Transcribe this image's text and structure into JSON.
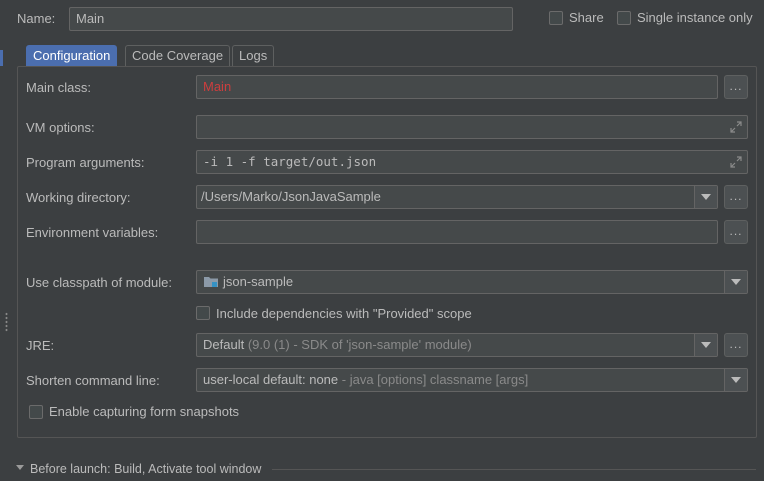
{
  "header": {
    "name_label": "Name:",
    "name_value": "Main",
    "share_label": "Share",
    "single_instance_label": "Single instance only"
  },
  "tabs": [
    {
      "label": "Configuration",
      "active": true
    },
    {
      "label": "Code Coverage",
      "active": false
    },
    {
      "label": "Logs",
      "active": false
    }
  ],
  "form": {
    "main_class_label": "Main class:",
    "main_class_value": "Main",
    "vm_options_label": "VM options:",
    "vm_options_value": "",
    "program_args_label": "Program arguments:",
    "program_args_value": "-i 1 -f target/out.json",
    "working_dir_label": "Working directory:",
    "working_dir_value": "/Users/Marko/JsonJavaSample",
    "env_vars_label": "Environment variables:",
    "env_vars_value": "",
    "classpath_label": "Use classpath of module:",
    "classpath_value": "json-sample",
    "include_deps_label": "Include dependencies with \"Provided\" scope",
    "jre_label": "JRE:",
    "jre_value_main": "Default",
    "jre_value_detail": " (9.0 (1) - SDK of 'json-sample' module)",
    "shorten_label": "Shorten command line:",
    "shorten_value_main": "user-local default: none",
    "shorten_value_detail": " - java [options] classname [args]",
    "form_snapshots_label": "Enable capturing form snapshots",
    "browse_button_label": "..."
  },
  "footer": {
    "before_launch_label": "Before launch: Build, Activate tool window"
  },
  "colors": {
    "background": "#3c3f41",
    "field_bg": "#45494a",
    "border": "#646464",
    "active_tab": "#4b6eaf",
    "error_text": "#cc3e3e",
    "text": "#bbbbbb"
  },
  "icons": {
    "expand": "expand-icon",
    "dropdown": "chevron-down-icon",
    "module": "module-folder-icon",
    "collapse": "triangle-down-icon"
  }
}
